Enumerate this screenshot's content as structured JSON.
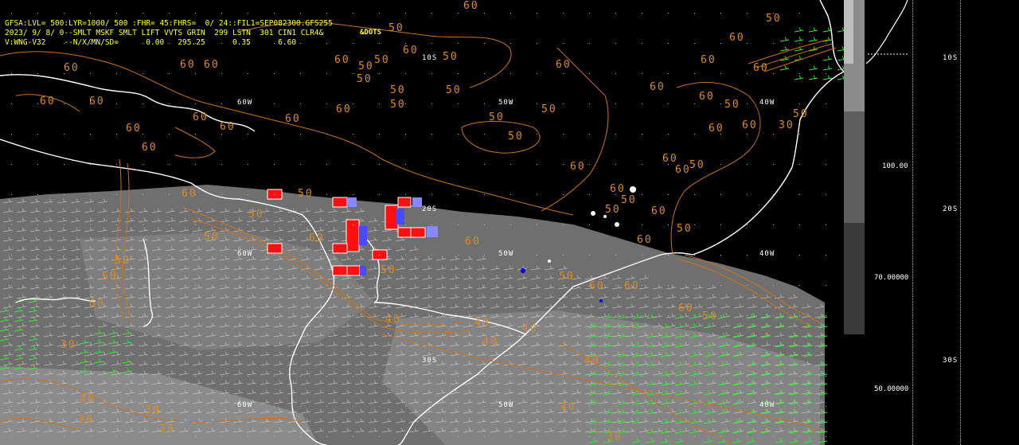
{
  "header": {
    "line1": "GFSA:LVL= 500:LYR=1000/ 500 :FHR= 45:FHRS=  0/ 24::FIL1=SEP082300.GFS255",
    "line2": "2023/ 9/ 8/ 0--SMLT MSKF SMLT LIFT VVTS GRIN  299 LSTN  301 CIN1 CLR4&",
    "line3": "V:WNG-V32    --N/X/MN/SD=      0.00   295.25      0.35      6.60",
    "dots": "&DOTS"
  },
  "map": {
    "lon_labels": [
      {
        "id": "60w-top",
        "text": "60W"
      },
      {
        "id": "50w-top",
        "text": "50W"
      },
      {
        "id": "40w-top",
        "text": "40W"
      },
      {
        "id": "60w-mid",
        "text": "60W"
      },
      {
        "id": "50w-mid",
        "text": "50W"
      },
      {
        "id": "40w-mid",
        "text": "40W"
      },
      {
        "id": "60w-bot",
        "text": "60W"
      },
      {
        "id": "50w-bot",
        "text": "50W"
      },
      {
        "id": "40w-bot",
        "text": "40W"
      }
    ],
    "lat_labels": [
      {
        "id": "10s",
        "text": "10S"
      },
      {
        "id": "20s",
        "text": "20S"
      },
      {
        "id": "30s",
        "text": "30S"
      }
    ],
    "contour_values": [
      "60",
      "50",
      "40",
      "30"
    ]
  },
  "colorbar": {
    "ticks": [
      "100.00",
      "70.00000",
      "50.00000"
    ],
    "lat_labels": [
      "10S",
      "20S",
      "30S"
    ],
    "colors": [
      "#bdbdbd",
      "#8c8c8c",
      "#5e5e5e",
      "#3a3a3a"
    ]
  },
  "colors": {
    "contour": "#c8741c",
    "header": "#ffff33",
    "coast": "#ffffff",
    "wind_green": "#33ee33",
    "alert_red": "#ff1010",
    "alert_blue": "#4a4aff"
  }
}
